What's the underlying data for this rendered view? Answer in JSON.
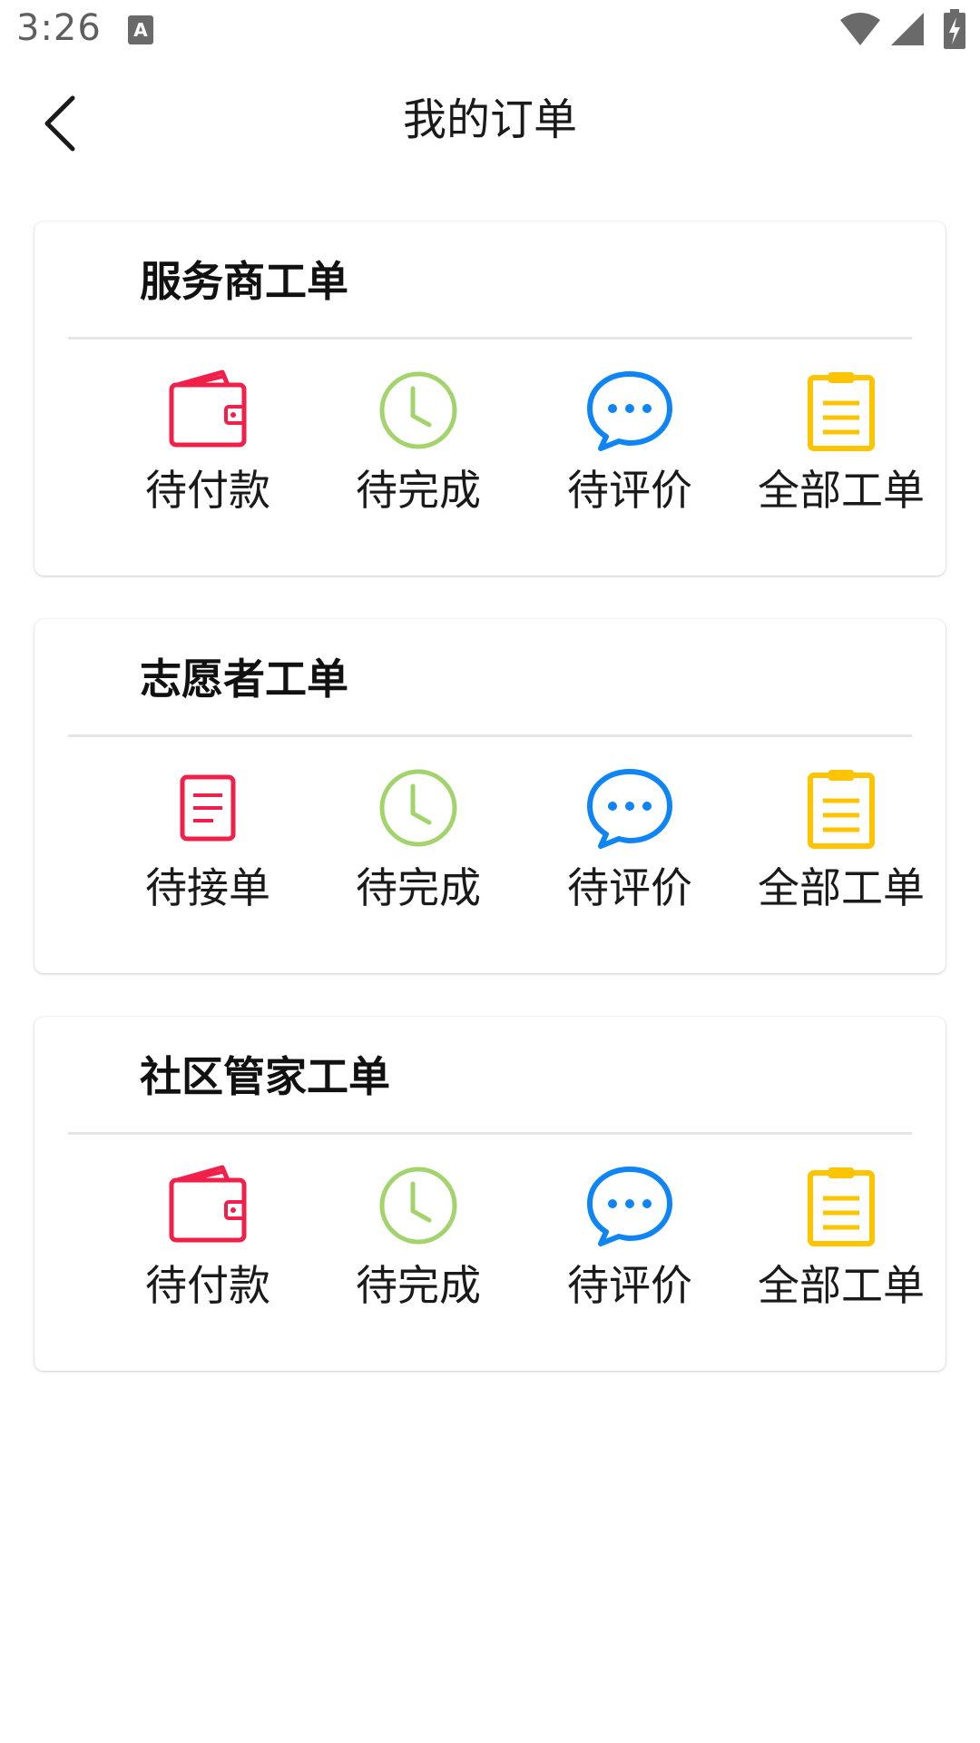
{
  "status_bar": {
    "time": "3:26",
    "icons": [
      "a-notification-icon",
      "wifi-icon",
      "signal-icon",
      "battery-icon"
    ]
  },
  "header": {
    "back_icon": "chevron-left-icon",
    "title": "我的订单"
  },
  "colors": {
    "red": "#f0204a",
    "green": "#a3d36b",
    "blue": "#0f84f4",
    "yellow": "#ffc400"
  },
  "cards": [
    {
      "title": "服务商工单",
      "actions": [
        {
          "label": "待付款",
          "icon": "wallet-icon"
        },
        {
          "label": "待完成",
          "icon": "clock-icon"
        },
        {
          "label": "待评价",
          "icon": "chat-bubble-icon"
        },
        {
          "label": "全部工单",
          "icon": "clipboard-icon"
        }
      ]
    },
    {
      "title": "志愿者工单",
      "actions": [
        {
          "label": "待接单",
          "icon": "document-icon"
        },
        {
          "label": "待完成",
          "icon": "clock-icon"
        },
        {
          "label": "待评价",
          "icon": "chat-bubble-icon"
        },
        {
          "label": "全部工单",
          "icon": "clipboard-icon"
        }
      ]
    },
    {
      "title": "社区管家工单",
      "actions": [
        {
          "label": "待付款",
          "icon": "wallet-icon"
        },
        {
          "label": "待完成",
          "icon": "clock-icon"
        },
        {
          "label": "待评价",
          "icon": "chat-bubble-icon"
        },
        {
          "label": "全部工单",
          "icon": "clipboard-icon"
        }
      ]
    }
  ]
}
